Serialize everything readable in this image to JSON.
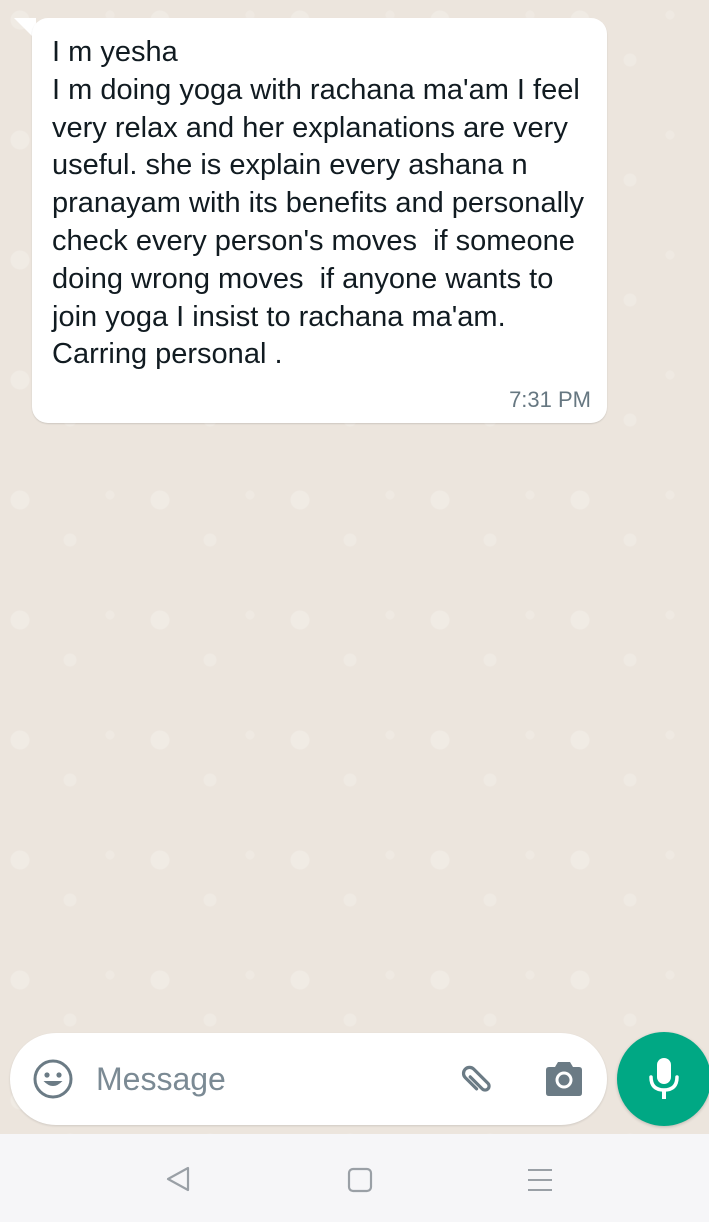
{
  "message": {
    "text": "I m yesha\nI m doing yoga with rachana ma'am I feel very relax and her explanations are very useful. she is explain every ashana n pranayam with its benefits and personally check every person's moves  if someone doing wrong moves  if anyone wants to join yoga I insist to rachana ma'am. Carring personal .",
    "time": "7:31 PM"
  },
  "composer": {
    "placeholder": "Message",
    "emoji_icon": "emoji-icon",
    "attach_icon": "paperclip-icon",
    "camera_icon": "camera-icon",
    "mic_icon": "microphone-icon",
    "accent_color": "#00a884"
  },
  "nav": {
    "back_icon": "back-triangle-icon",
    "home_icon": "home-square-icon",
    "menu_icon": "menu-lines-icon"
  }
}
